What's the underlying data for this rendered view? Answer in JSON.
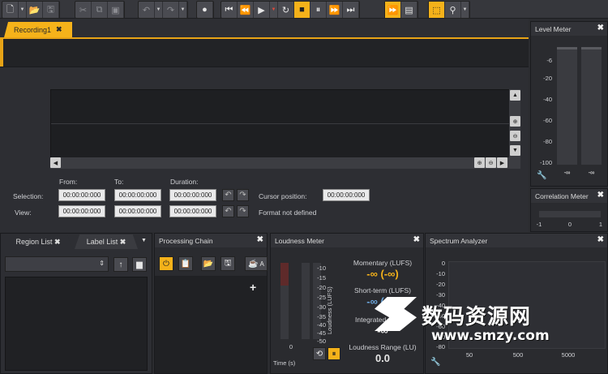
{
  "toolbar": {
    "buttons": [
      {
        "name": "new-file-icon",
        "glyph": "🗋"
      },
      {
        "name": "open-folder-icon",
        "glyph": "📂"
      },
      {
        "name": "save-icon",
        "glyph": "💾"
      },
      {
        "name": "cut-icon",
        "glyph": "✂"
      },
      {
        "name": "copy-icon",
        "glyph": "⧉"
      },
      {
        "name": "paste-icon",
        "glyph": "📋"
      },
      {
        "name": "undo-icon",
        "glyph": "↶"
      },
      {
        "name": "redo-icon",
        "glyph": "↷"
      },
      {
        "name": "record-icon",
        "glyph": "●"
      },
      {
        "name": "go-start-icon",
        "glyph": "⏮"
      },
      {
        "name": "rewind-icon",
        "glyph": "⏪"
      },
      {
        "name": "play-icon",
        "glyph": "▶"
      },
      {
        "name": "loop-icon",
        "glyph": "↻"
      },
      {
        "name": "stop-icon",
        "glyph": "■"
      },
      {
        "name": "pause-icon",
        "glyph": "⏸"
      },
      {
        "name": "fast-forward-icon",
        "glyph": "⏩"
      },
      {
        "name": "go-end-icon",
        "glyph": "⏭"
      },
      {
        "name": "follow-cursor-icon",
        "glyph": "⏩"
      },
      {
        "name": "waveform-view-icon",
        "glyph": "▤"
      },
      {
        "name": "snap-icon",
        "glyph": "⬚"
      },
      {
        "name": "zoom-tool-icon",
        "glyph": "⚲"
      }
    ]
  },
  "document": {
    "tab_label": "Recording1",
    "close_glyph": "✖"
  },
  "selection": {
    "col_from": "From:",
    "col_to": "To:",
    "col_duration": "Duration:",
    "row_selection": "Selection:",
    "row_view": "View:",
    "sel_from": "00:00:00:000",
    "sel_to": "00:00:00:000",
    "sel_duration": "00:00:00:000",
    "view_from": "00:00:00:000",
    "view_to": "00:00:00:000",
    "view_duration": "00:00:00:000",
    "cursor_label": "Cursor position:",
    "cursor_value": "00:00:00:000",
    "format_text": "Format not defined"
  },
  "level_meter": {
    "title": "Level Meter",
    "ticks": [
      "-6",
      "-20",
      "-40",
      "-60",
      "-80",
      "-100"
    ],
    "left_value": "-∞",
    "right_value": "-∞"
  },
  "correlation_meter": {
    "title": "Correlation Meter",
    "ticks": [
      "-1",
      "0",
      "1"
    ]
  },
  "region_panel": {
    "tab_region": "Region List",
    "tab_label": "Label List"
  },
  "processing_chain": {
    "title": "Processing Chain",
    "label_a": "A"
  },
  "loudness_meter": {
    "title": "Loudness Meter",
    "ticks": [
      "-10",
      "-15",
      "-20",
      "-25",
      "-30",
      "-35",
      "-40",
      "-45",
      "-50"
    ],
    "axis_label": "Loudness (LUFS)",
    "time_label": "Time (s)",
    "zero_label": "0",
    "momentary_label": "Momentary (LUFS)",
    "momentary_value": "-∞ (-∞)",
    "shortterm_label": "Short-term (LUFS)",
    "shortterm_value": "-∞ (-∞)",
    "integrated_label": "Integrated (LUFS)",
    "integrated_value": "-∞",
    "range_label": "Loudness Range (LU)",
    "range_value": "0.0"
  },
  "spectrum_analyzer": {
    "title": "Spectrum Analyzer",
    "y_ticks": [
      "0",
      "-10",
      "-20",
      "-30",
      "-40",
      "-50",
      "-60",
      "-70",
      "-80"
    ],
    "x_ticks": [
      "50",
      "500",
      "5000"
    ]
  },
  "watermark": {
    "line1": "数码资源网",
    "line2": "www.smzy.com"
  }
}
